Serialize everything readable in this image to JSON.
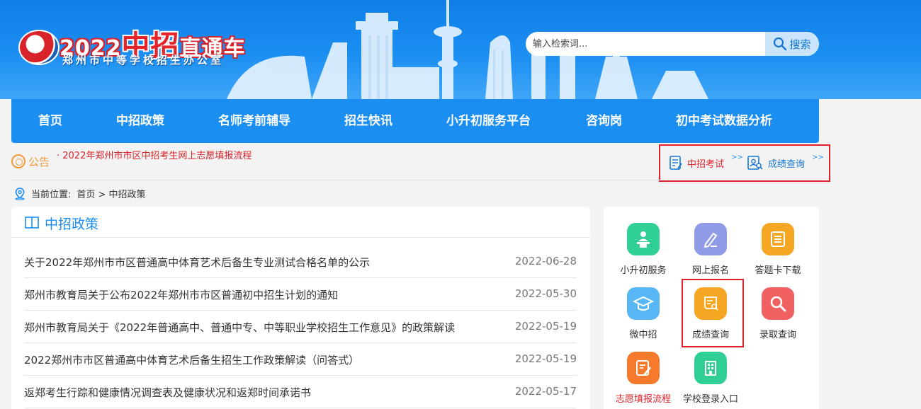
{
  "header": {
    "logo_year": "2022",
    "logo_big": "中招",
    "logo_rest": "直通车",
    "logo_subtitle": "郑州市中等学校招生办公室",
    "search_placeholder": "输入检索词...",
    "search_button": "搜索"
  },
  "nav": {
    "items": [
      {
        "label": "首页"
      },
      {
        "label": "中招政策"
      },
      {
        "label": "名师考前辅导"
      },
      {
        "label": "招生快讯"
      },
      {
        "label": "小升初服务平台"
      },
      {
        "label": "咨询岗"
      },
      {
        "label": "初中考试数据分析"
      }
    ]
  },
  "notice": {
    "label": "公告",
    "text": "· 2022年郑州市市区中招考生网上志愿填报流程"
  },
  "quick_links": [
    {
      "label": "中招考试",
      "icon": "exam-doc-icon",
      "color": "#e0212b"
    },
    {
      "label": "成绩查询",
      "icon": "score-search-icon",
      "color": "#1677d2"
    }
  ],
  "breadcrumb": {
    "label": "当前位置:",
    "path": "首页 > 中招政策"
  },
  "policy": {
    "title": "中招政策",
    "items": [
      {
        "title": "关于2022年郑州市市区普通高中体育艺术后备生专业测试合格名单的公示",
        "date": "2022-06-28"
      },
      {
        "title": "郑州市教育局关于公布2022年郑州市市区普通初中招生计划的通知",
        "date": "2022-05-30"
      },
      {
        "title": "郑州市教育局关于《2022年普通高中、普通中专、中等职业学校招生工作意见》的政策解读",
        "date": "2022-05-19"
      },
      {
        "title": "2022郑州市市区普通高中体育艺术后备生招生工作政策解读（问答式）",
        "date": "2022-05-19"
      },
      {
        "title": "返郑考生行踪和健康情况调查表及健康状况和返郑时间承诺书",
        "date": "2022-05-17"
      }
    ]
  },
  "services": [
    {
      "label": "小升初服务",
      "icon": "teacher-podium-icon",
      "color": "#2fcf96"
    },
    {
      "label": "网上报名",
      "icon": "pen-register-icon",
      "color": "#8f9be6"
    },
    {
      "label": "答题卡下载",
      "icon": "answer-sheet-icon",
      "color": "#f5a623"
    },
    {
      "label": "微中招",
      "icon": "graduation-cap-icon",
      "color": "#5ab7f5"
    },
    {
      "label": "成绩查询",
      "icon": "score-certificate-icon",
      "color": "#f5a623"
    },
    {
      "label": "录取查询",
      "icon": "magnifier-icon",
      "color": "#f26161"
    },
    {
      "label": "志愿填报流程",
      "icon": "form-edit-icon",
      "color": "#f57a2c"
    },
    {
      "label": "学校登录入口",
      "icon": "building-icon",
      "color": "#2fcf96"
    }
  ]
}
